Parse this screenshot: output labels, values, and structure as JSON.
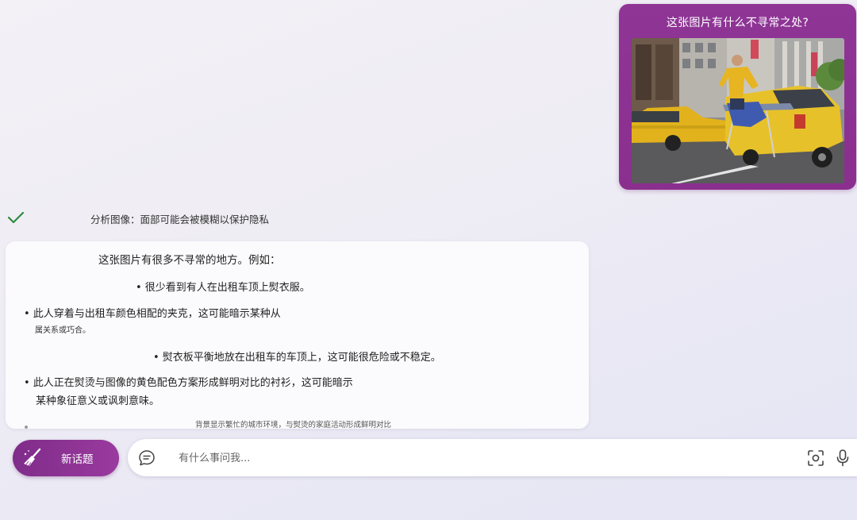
{
  "conversation": {
    "user_message": {
      "text": "这张图片有什么不寻常之处?",
      "image_icon": "taxi-ironing-photo"
    },
    "status": {
      "icon": "checkmark-icon",
      "text": "分析图像：面部可能会被模糊以保护隐私"
    },
    "response": {
      "intro": "这张图片有很多不寻常的地方。例如：",
      "bullets": [
        "• 很少看到有人在出租车顶上熨衣服。",
        "• 此人穿着与出租车颜色相配的夹克，这可能暗示某种从",
        "属关系或巧合。",
        "• 熨衣板平衡地放在出租车的车顶上，这可能很危险或不稳定。",
        "• 此人正在熨烫与图像的黄色配色方案形成鲜明对比的衬衫，这可能暗示",
        "某种象征意义或讽刺意味。",
        "背景显示繁忙的城市环境，与熨烫的家庭活动形成鲜明对比"
      ]
    }
  },
  "composer": {
    "new_topic_label": "新话题",
    "new_topic_icon": "broom-icon",
    "placeholder": "有什么事问我...",
    "chat_icon": "chat-bubble-icon",
    "camera_icon": "visual-search-icon",
    "mic_icon": "microphone-icon"
  },
  "colors": {
    "accent": "#8e3596",
    "accent_dark": "#7f2c8a",
    "check": "#2e8a3e",
    "background": "#efedf4"
  }
}
